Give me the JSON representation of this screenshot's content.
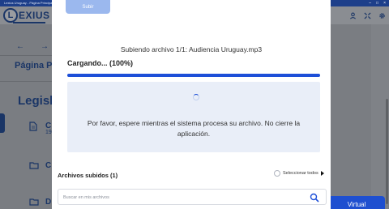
{
  "titlebar": {
    "title": "Lexius Uruguay - Página Principal"
  },
  "background": {
    "logo_letter": "L",
    "logo_text": "EXIUS",
    "page_title": "Página Pri",
    "section_title": "Legisla",
    "doc_rows": [
      {
        "label": "C",
        "sub": "19"
      },
      {
        "label": "C"
      },
      {
        "label": "D"
      }
    ],
    "virtual_button_label": "Virtual"
  },
  "modal": {
    "submit_label": "Subir",
    "upload_status": "Subiendo archivo 1/1: Audiencia Uruguay.mp3",
    "loading_label": "Cargando... (100%)",
    "progress_percent": 100,
    "info_text": "Por favor, espere mientras el sistema procesa su archivo. No cierre la aplicación.",
    "uploaded_title": "Archivos subidos (1)",
    "select_all_label": "Seleccionar todos",
    "search": {
      "placeholder": "Buscar en mis archivos",
      "value": ""
    }
  },
  "colors": {
    "accent": "#1d4fd8",
    "brand": "#1a3566"
  }
}
